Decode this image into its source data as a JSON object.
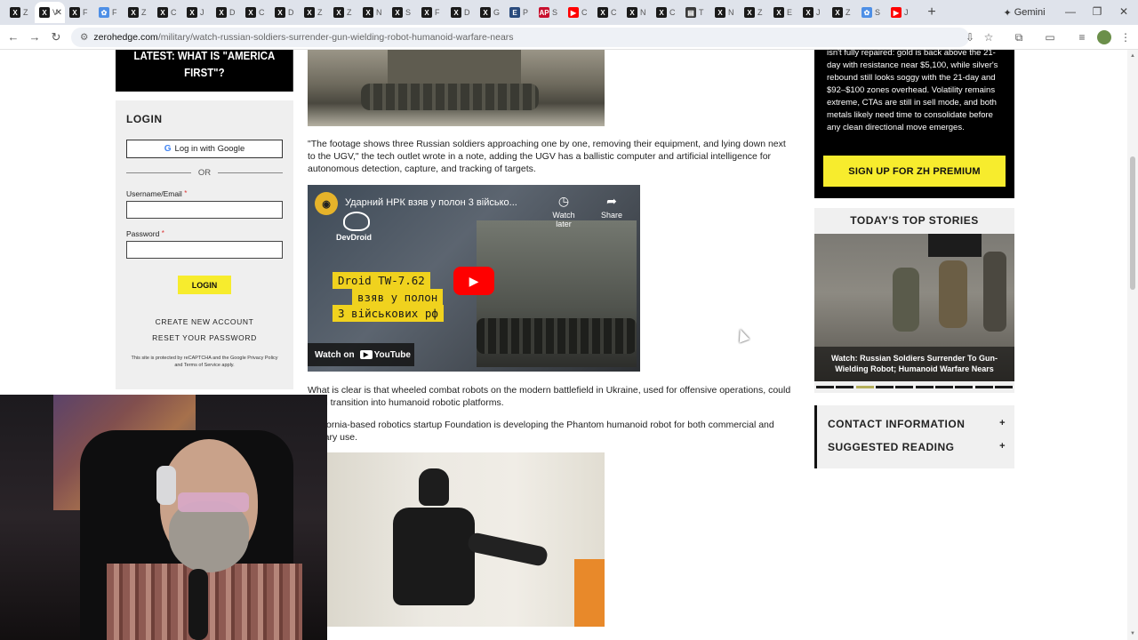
{
  "browser": {
    "tabs": [
      {
        "icon": "x-logo-icon",
        "fav_text": "X",
        "label": "Z",
        "color": "#1a1a1a"
      },
      {
        "icon": "x-logo-icon",
        "fav_text": "X",
        "label": "V",
        "active": true,
        "color": "#1a1a1a"
      },
      {
        "icon": "x-logo-icon",
        "fav_text": "X",
        "label": "F",
        "color": "#1a1a1a"
      },
      {
        "icon": "bluesky-icon",
        "fav_text": "✿",
        "label": "F",
        "color": "#4e8fe6"
      },
      {
        "icon": "x-logo-icon",
        "fav_text": "X",
        "label": "Z",
        "color": "#1a1a1a"
      },
      {
        "icon": "x-logo-icon",
        "fav_text": "X",
        "label": "C",
        "color": "#1a1a1a"
      },
      {
        "icon": "x-logo-icon",
        "fav_text": "X",
        "label": "J",
        "color": "#1a1a1a"
      },
      {
        "icon": "x-logo-icon",
        "fav_text": "X",
        "label": "D",
        "color": "#1a1a1a"
      },
      {
        "icon": "x-logo-icon",
        "fav_text": "X",
        "label": "C",
        "color": "#1a1a1a"
      },
      {
        "icon": "x-logo-icon",
        "fav_text": "X",
        "label": "D",
        "color": "#1a1a1a"
      },
      {
        "icon": "x-logo-icon",
        "fav_text": "X",
        "label": "Z",
        "color": "#1a1a1a"
      },
      {
        "icon": "x-logo-icon",
        "fav_text": "X",
        "label": "Z",
        "color": "#1a1a1a"
      },
      {
        "icon": "x-logo-icon",
        "fav_text": "X",
        "label": "N",
        "color": "#1a1a1a"
      },
      {
        "icon": "x-logo-icon",
        "fav_text": "X",
        "label": "S",
        "color": "#1a1a1a"
      },
      {
        "icon": "x-logo-icon",
        "fav_text": "X",
        "label": "F",
        "color": "#1a1a1a"
      },
      {
        "icon": "x-logo-icon",
        "fav_text": "X",
        "label": "D",
        "color": "#1a1a1a"
      },
      {
        "icon": "x-logo-icon",
        "fav_text": "X",
        "label": "G",
        "color": "#1a1a1a"
      },
      {
        "icon": "ep-icon",
        "fav_text": "E",
        "label": "P",
        "color": "#2a4b7c"
      },
      {
        "icon": "ap-icon",
        "fav_text": "AP",
        "label": "S",
        "color": "#c8102e"
      },
      {
        "icon": "youtube-icon",
        "fav_text": "▶",
        "label": "C",
        "color": "#ff0000"
      },
      {
        "icon": "x-logo-icon",
        "fav_text": "X",
        "label": "C",
        "color": "#1a1a1a"
      },
      {
        "icon": "x-logo-icon",
        "fav_text": "X",
        "label": "N",
        "color": "#1a1a1a"
      },
      {
        "icon": "x-logo-icon",
        "fav_text": "X",
        "label": "C",
        "color": "#1a1a1a"
      },
      {
        "icon": "news-icon",
        "fav_text": "▤",
        "label": "T",
        "color": "#3a3a3a"
      },
      {
        "icon": "x-logo-icon",
        "fav_text": "X",
        "label": "N",
        "color": "#1a1a1a"
      },
      {
        "icon": "x-logo-icon",
        "fav_text": "X",
        "label": "Z",
        "color": "#1a1a1a"
      },
      {
        "icon": "x-logo-icon",
        "fav_text": "X",
        "label": "E",
        "color": "#1a1a1a"
      },
      {
        "icon": "x-logo-icon",
        "fav_text": "X",
        "label": "J",
        "color": "#1a1a1a"
      },
      {
        "icon": "x-logo-icon",
        "fav_text": "X",
        "label": "Z",
        "color": "#1a1a1a"
      },
      {
        "icon": "bluesky-icon",
        "fav_text": "✿",
        "label": "S",
        "color": "#4e8fe6"
      },
      {
        "icon": "youtube-icon",
        "fav_text": "▶",
        "label": "J",
        "color": "#ff0000"
      }
    ],
    "new_tab": "+",
    "gemini_label": "Gemini",
    "url_host": "zerohedge.com",
    "url_path": "/military/watch-russian-soldiers-surrender-gun-wielding-robot-humanoid-warfare-nears"
  },
  "left_sidebar": {
    "promo_line1": "LATEST: WHAT IS \"AMERICA",
    "promo_line2": "FIRST\"?",
    "login_title": "LOGIN",
    "google_button": "Log in with Google",
    "or_text": "OR",
    "username_label": "Username/Email",
    "password_label": "Password",
    "required_mark": "*",
    "login_button": "LOGIN",
    "create_account": "CREATE NEW ACCOUNT",
    "reset_password": "RESET YOUR PASSWORD",
    "recaptcha_note": "This site is protected by reCAPTCHA and the Google Privacy Policy and Terms of Service apply."
  },
  "article": {
    "para1": "\"The footage shows three Russian soldiers approaching one by one, removing their equipment, and lying down next to the UGV,\" the tech outlet wrote in a note, adding the UGV has a ballistic computer and artificial intelligence for autonomous detection, capture, and tracking of targets.",
    "video": {
      "title": "Ударний НРК взяв у полон 3 військо...",
      "channel": "DevDroid",
      "watch_later": "Watch later",
      "share": "Share",
      "overlay_line1": "Droid TW-7.62",
      "overlay_line2": "взяв у полон",
      "overlay_line3": "3 військових рф",
      "watch_on": "Watch on",
      "youtube": "YouTube"
    },
    "para2": "What is clear is that wheeled combat robots on the modern battlefield in Ukraine, used for offensive operations, could soon transition into humanoid robotic platforms.",
    "para3": "California-based robotics startup Foundation is developing the Phantom humanoid robot for both commercial and military use."
  },
  "right_sidebar": {
    "premium_text": "isn't fully repaired: gold is back above the 21-day with resistance near $5,100, while silver's rebound still looks soggy with the 21-day and $92–$100 zones overhead. Volatility remains extreme, CTAs are still in sell mode, and both metals likely need time to consolidate before any clean directional move emerges.",
    "premium_button": "SIGN UP FOR ZH PREMIUM",
    "top_stories_title": "TODAY'S TOP STORIES",
    "story_caption": "Watch: Russian Soldiers Surrender To Gun-Wielding Robot; Humanoid Warfare Nears",
    "carousel_count": 10,
    "carousel_active": 2,
    "contact_info": "CONTACT INFORMATION",
    "suggested_reading": "SUGGESTED READING",
    "expand_symbol": "+"
  },
  "colors": {
    "accent_yellow": "#f7ec2d",
    "black_box": "#000000",
    "panel_gray": "#efefef"
  }
}
